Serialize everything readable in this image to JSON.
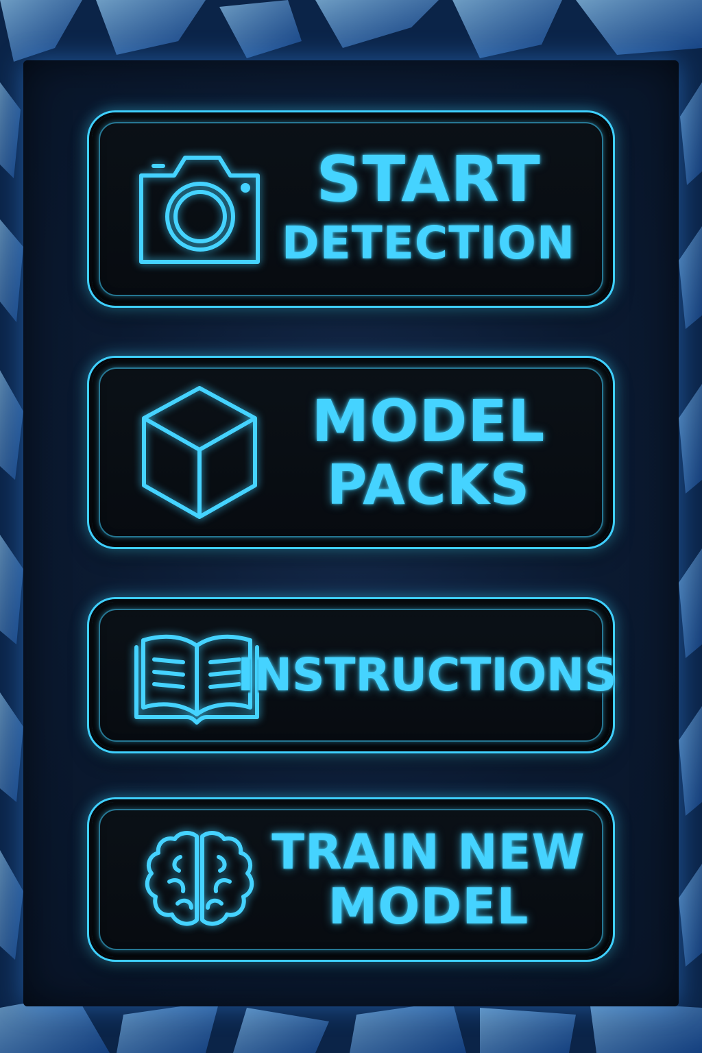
{
  "menu": {
    "buttons": [
      {
        "id": "start-detection",
        "icon": "camera-icon",
        "lines": [
          "START",
          "DETECTION"
        ]
      },
      {
        "id": "model-packs",
        "icon": "cube-icon",
        "lines": [
          "MODEL",
          "PACKS"
        ]
      },
      {
        "id": "instructions",
        "icon": "open-book-icon",
        "lines": [
          "INSTRUCTIONS"
        ]
      },
      {
        "id": "train-new-model",
        "icon": "brain-icon",
        "lines": [
          "TRAIN NEW",
          "MODEL"
        ]
      }
    ]
  },
  "colors": {
    "accent": "#45d3ff",
    "button_bg": "#070b10",
    "background": "#0a1d3a"
  }
}
